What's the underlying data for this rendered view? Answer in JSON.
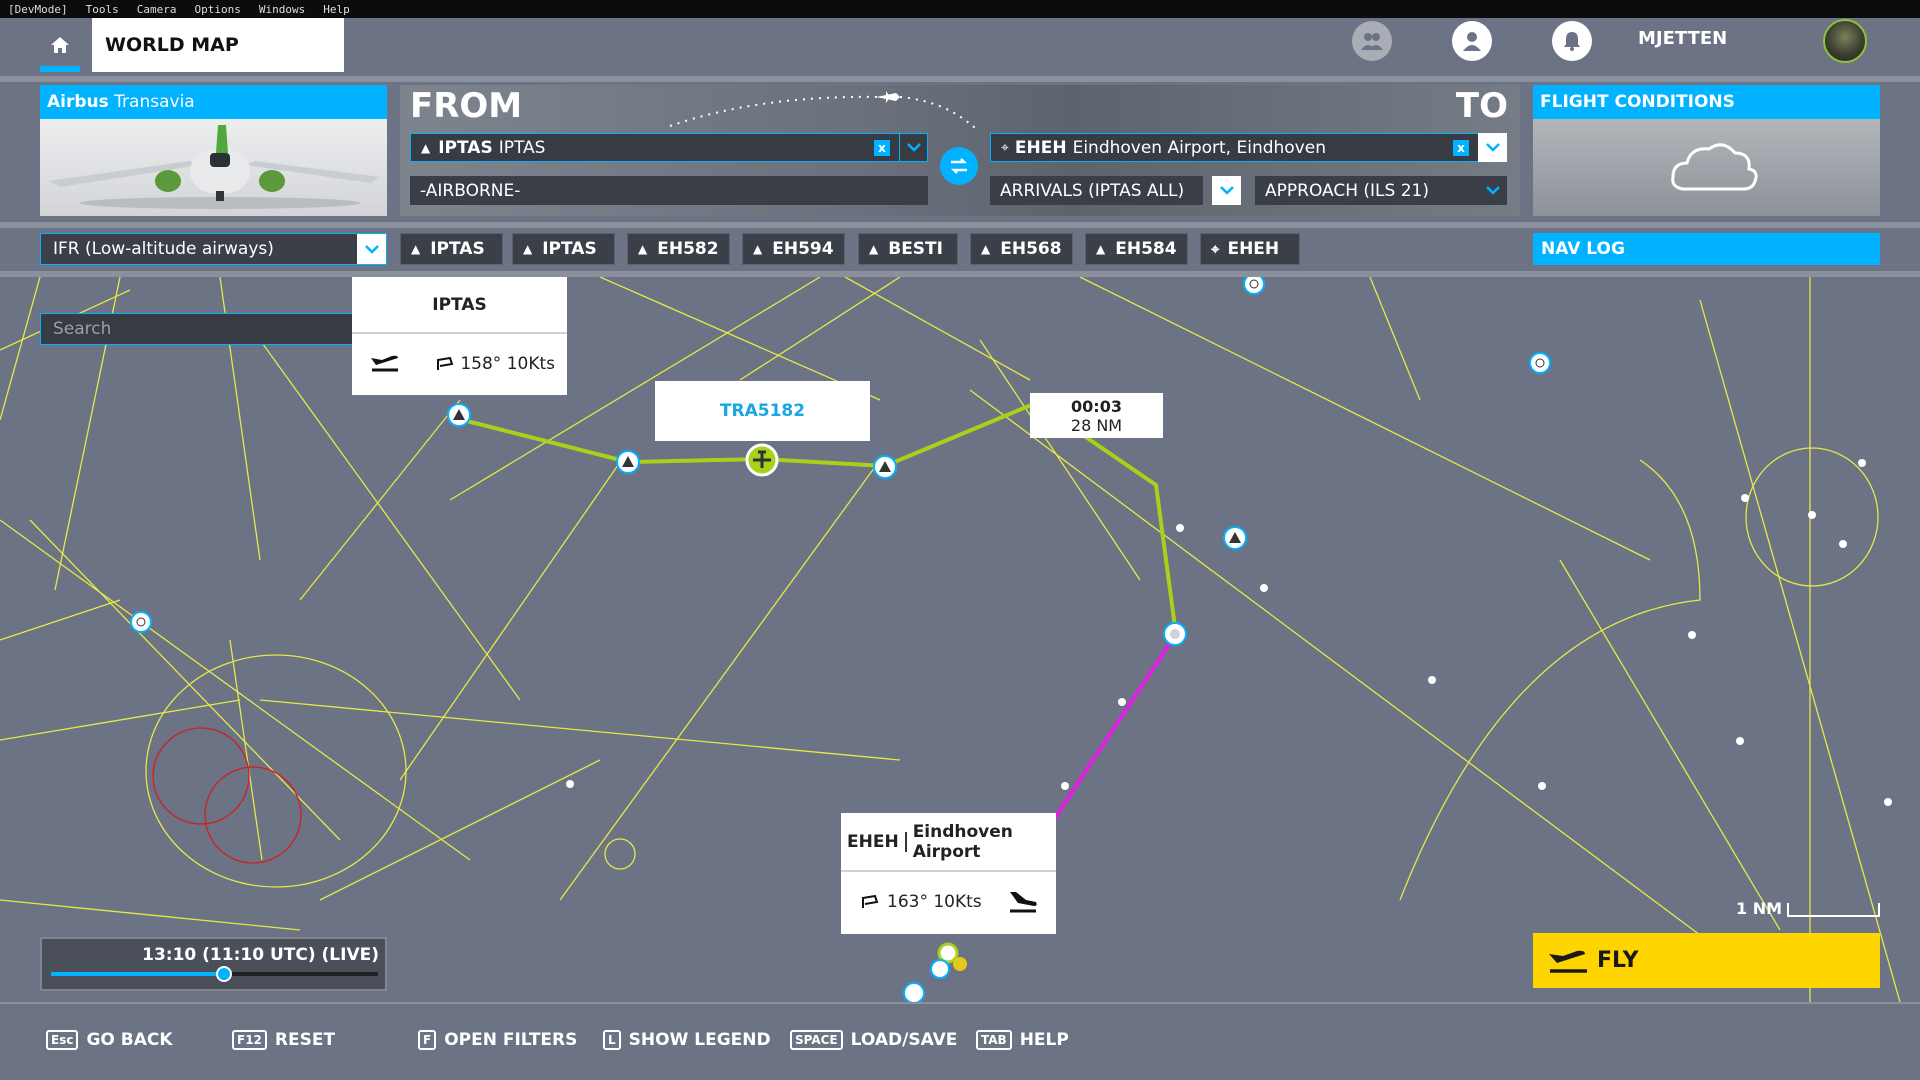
{
  "devmenu": [
    "[DevMode]",
    "Tools",
    "Camera",
    "Options",
    "Windows",
    "Help"
  ],
  "header": {
    "title": "WORLD MAP",
    "username": "MJETTEN"
  },
  "aircraft": {
    "brand": "Airbus",
    "livery": "Transavia"
  },
  "route": {
    "from_label": "FROM",
    "to_label": "TO",
    "departure": {
      "code": "IPTAS",
      "name": "IPTAS"
    },
    "departure_state": "-AIRBORNE-",
    "arrival": {
      "code": "EHEH",
      "name": "Eindhoven Airport, Eindhoven"
    },
    "arrivals_select": "ARRIVALS (IPTAS ALL)",
    "approach_select": "APPROACH (ILS 21)"
  },
  "conditions": {
    "title": "FLIGHT CONDITIONS"
  },
  "flight_type": "IFR (Low-altitude airways)",
  "waypoints": [
    "IPTAS",
    "IPTAS",
    "EH582",
    "EH594",
    "BESTI",
    "EH568",
    "EH584",
    "EHEH"
  ],
  "navlog": "NAV LOG",
  "search": {
    "placeholder": "Search"
  },
  "popups": {
    "iptas": {
      "title": "IPTAS",
      "wind": "158° 10Kts"
    },
    "flight": {
      "callsign": "TRA5182"
    },
    "leg": {
      "time": "00:03",
      "distance": "28 NM"
    },
    "eheh": {
      "code": "EHEH",
      "name": "Eindhoven Airport",
      "wind": "163° 10Kts"
    }
  },
  "time": {
    "label": "13:10 (11:10 UTC) (LIVE)",
    "progress": 0.53
  },
  "scale": {
    "label": "1 NM"
  },
  "fly": {
    "label": "FLY"
  },
  "bottom_hints": [
    {
      "key": "Esc",
      "label": "GO BACK"
    },
    {
      "key": "F12",
      "label": "RESET"
    },
    {
      "key": "F",
      "label": "OPEN FILTERS"
    },
    {
      "key": "L",
      "label": "SHOW LEGEND"
    },
    {
      "key": "SPACE",
      "label": "LOAD/SAVE"
    },
    {
      "key": "TAB",
      "label": "HELP"
    }
  ],
  "colors": {
    "accent": "#00b2ff",
    "route": "#a8d21a",
    "approach": "#e020e0",
    "airways": "#e6e84a",
    "restricted": "#d02020",
    "fly": "#ffd500"
  }
}
